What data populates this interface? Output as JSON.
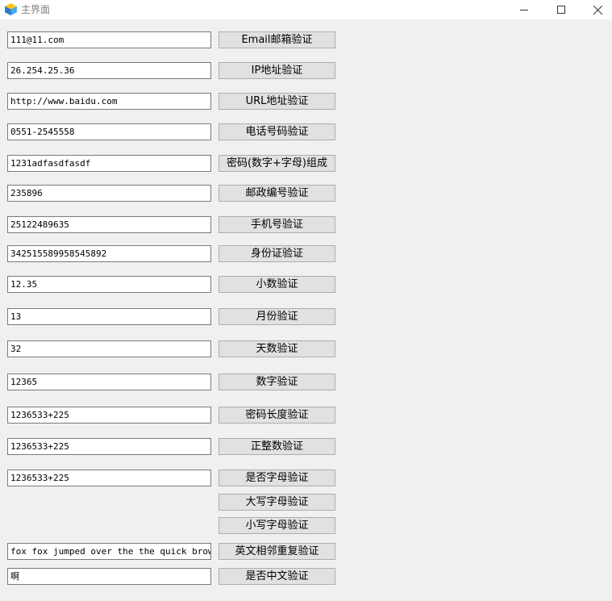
{
  "window": {
    "title": "主界面"
  },
  "rows": [
    {
      "value": "111@11.com",
      "button": "Email邮箱验证"
    },
    {
      "value": "26.254.25.36",
      "button": "IP地址验证"
    },
    {
      "value": "http://www.baidu.com",
      "button": "URL地址验证"
    },
    {
      "value": "0551-2545558",
      "button": "电话号码验证"
    },
    {
      "value": "1231adfasdfasdf",
      "button": "密码(数字+字母)组成"
    },
    {
      "value": "235896",
      "button": "邮政编号验证"
    },
    {
      "value": "25122489635",
      "button": "手机号验证"
    },
    {
      "value": "342515589958545892",
      "button": "身份证验证"
    },
    {
      "value": "12.35",
      "button": "小数验证"
    },
    {
      "value": "13",
      "button": "月份验证"
    },
    {
      "value": "32",
      "button": "天数验证"
    },
    {
      "value": "12365",
      "button": "数字验证"
    },
    {
      "value": "1236533+225",
      "button": "密码长度验证"
    },
    {
      "value": "1236533+225",
      "button": "正整数验证"
    },
    {
      "value": "1236533+225",
      "button": "是否字母验证"
    }
  ],
  "extra_buttons": {
    "uppercase": "大写字母验证",
    "lowercase": "小写字母验证",
    "repeat_word": "英文相邻重复验证",
    "chinese": "是否中文验证"
  },
  "repeat_input": {
    "value": "fox  fox jumped over the the quick brown"
  },
  "chinese_input": {
    "value": "啊"
  }
}
